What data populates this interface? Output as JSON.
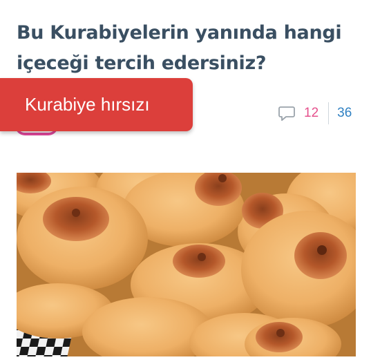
{
  "post": {
    "title": "Bu Kurabiyelerin yanında hangi içeceği tercih edersiniz?",
    "category_banner": "Kurabiye hırsızı",
    "comment_count": "12",
    "like_count": "36"
  },
  "icons": {
    "comment": "comment-icon"
  },
  "colors": {
    "title": "#3a4f62",
    "banner_bg": "#dc3f3b",
    "comment_count": "#e5508c",
    "like_count": "#2f80c2"
  }
}
